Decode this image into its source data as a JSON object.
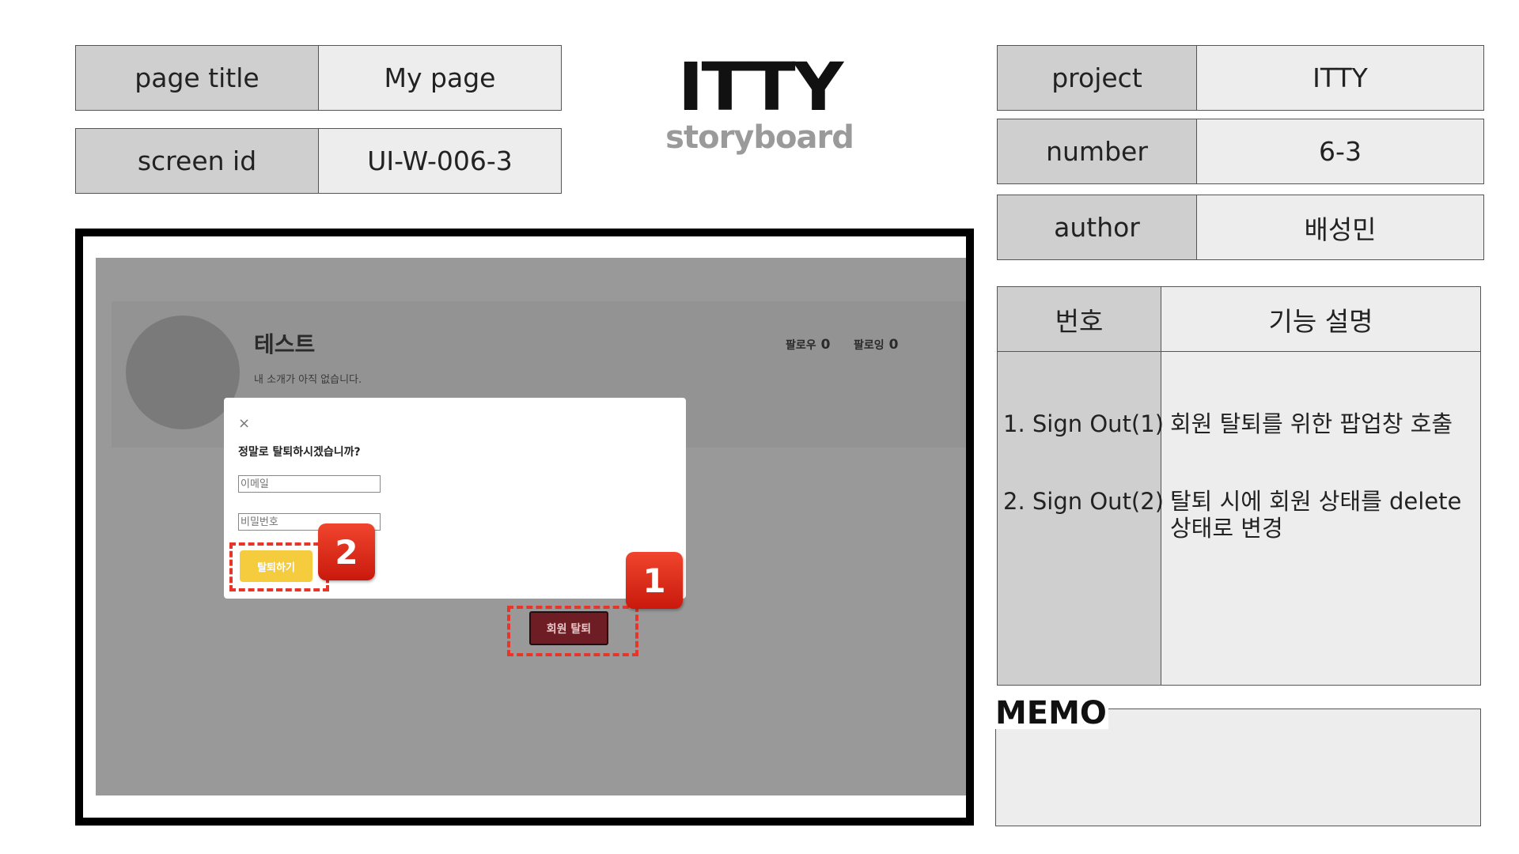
{
  "header": {
    "page_title_label": "page title",
    "page_title_value": "My page",
    "screen_id_label": "screen id",
    "screen_id_value": "UI-W-006-3"
  },
  "logo": {
    "main": "ITTY",
    "sub": "storyboard"
  },
  "meta": {
    "project_label": "project",
    "project_value": "ITTY",
    "number_label": "number",
    "number_value": "6-3",
    "author_label": "author",
    "author_value": "배성민"
  },
  "screen": {
    "username": "테스트",
    "bio": "내 소개가 아직 없습니다.",
    "follower_label": "팔로우",
    "follower_count": "0",
    "following_label": "팔로잉",
    "following_count": "0",
    "modal": {
      "close": "×",
      "question": "정말로 탈퇴하시겠습니까?",
      "email_placeholder": "이메일",
      "password_placeholder": "비밀번호",
      "confirm_button": "탈퇴하기"
    },
    "withdraw_button": "회원 탈퇴"
  },
  "annotations": {
    "badge1": "1",
    "badge2": "2"
  },
  "functions": {
    "header_no": "번호",
    "header_desc": "기능 설명",
    "rows": [
      {
        "no": "1. Sign Out(1)",
        "desc": "회원 탈퇴를 위한 팝업창 호출"
      },
      {
        "no": "2. Sign Out(2)",
        "desc_line1": "탈퇴 시에 회원 상태를 delete",
        "desc_line2": "상태로 변경"
      }
    ]
  },
  "memo": {
    "title": "MEMO"
  },
  "colors": {
    "label_bg": "#cfcfcf",
    "value_bg": "#ededed",
    "highlight": "#e8352a",
    "confirm_yellow": "#f5cc3e",
    "withdraw_red": "#6e1d24"
  }
}
